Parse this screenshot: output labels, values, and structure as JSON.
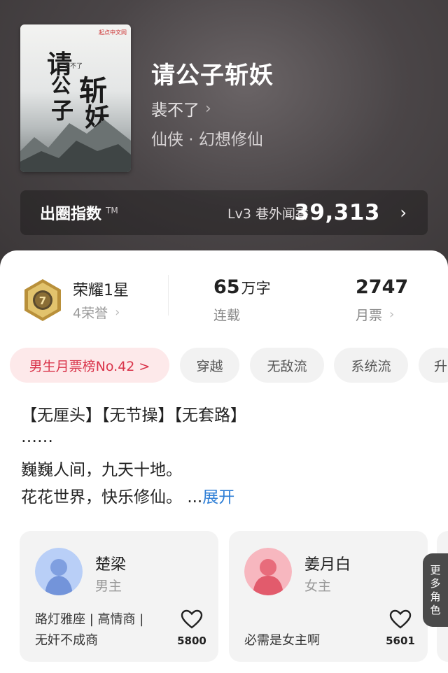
{
  "book": {
    "cover": {
      "publisher_mark": "起点中文网",
      "calligraphy": [
        "请",
        "公",
        "子",
        "斩",
        "妖"
      ],
      "cover_author": "裴不了"
    },
    "title": "请公子斩妖",
    "author": "裴不了",
    "author_chevron": "›",
    "genre": "仙侠 · 幻想修仙"
  },
  "circle_index": {
    "label": "出圈指数",
    "tm": "TM",
    "level": "Lv3 巷外闻香",
    "value": "39,313",
    "chevron": "›"
  },
  "stats": {
    "honor": {
      "title": "荣耀1星",
      "sub": "4荣誉",
      "badge_number": "7",
      "chevron": "›"
    },
    "words": {
      "number": "65",
      "unit": "万字",
      "status": "连载"
    },
    "monthly_votes": {
      "number": "2747",
      "label": "月票",
      "chevron": "›"
    }
  },
  "tags": [
    {
      "label": "男生月票榜No.42 >"
    },
    {
      "label": "穿越"
    },
    {
      "label": "无敌流"
    },
    {
      "label": "系统流"
    },
    {
      "label": "升"
    }
  ],
  "description": {
    "line1": "【无厘头】【无节操】【无套路】",
    "line2": "……",
    "line3": "巍巍人间，九天十地。",
    "line4_text": "花花世界，快乐修仙。",
    "ellipsis": "...",
    "expand": "展开"
  },
  "characters": [
    {
      "name": "楚梁",
      "role": "男主",
      "tags": [
        "路灯雅座 | 高情商 |",
        "无奸不成商"
      ],
      "likes": "5800",
      "color": "#8fb3f0"
    },
    {
      "name": "姜月白",
      "role": "女主",
      "tags": [
        "必需是女主啊"
      ],
      "likes": "5601",
      "color": "#f08a95"
    }
  ],
  "more_roles": [
    "更",
    "多",
    "角",
    "色"
  ]
}
